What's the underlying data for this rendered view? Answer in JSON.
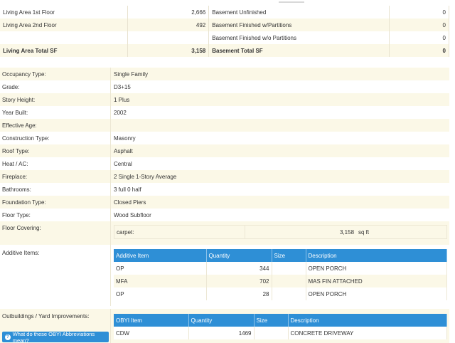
{
  "area_table": {
    "rows": [
      {
        "left_label": "Living Area 1st Floor",
        "left_value": "2,666",
        "right_label": "Basement Unfinished",
        "right_value": "0"
      },
      {
        "left_label": "Living Area 2nd Floor",
        "left_value": "492",
        "right_label": "Basement Finished w/Partitions",
        "right_value": "0"
      },
      {
        "left_label": "",
        "left_value": "",
        "right_label": "Basement Finished w/o Partitions",
        "right_value": "0"
      },
      {
        "left_label": "Living Area Total SF",
        "left_value": "3,158",
        "right_label": "Basement Total SF",
        "right_value": "0"
      }
    ]
  },
  "details": [
    {
      "label": "Occupancy Type:",
      "value": "Single Family"
    },
    {
      "label": "Grade:",
      "value": "D3+15"
    },
    {
      "label": "Story Height:",
      "value": "1 Plus"
    },
    {
      "label": "Year Built:",
      "value": "2002"
    },
    {
      "label": "Effective Age:",
      "value": ""
    },
    {
      "label": "Construction Type:",
      "value": "Masonry"
    },
    {
      "label": "Roof Type:",
      "value": "Asphalt"
    },
    {
      "label": "Heat / AC:",
      "value": "Central"
    },
    {
      "label": "Fireplace:",
      "value": "2 Single 1-Story Average"
    },
    {
      "label": "Bathrooms:",
      "value": "3 full 0 half"
    },
    {
      "label": "Foundation Type:",
      "value": "Closed Piers"
    },
    {
      "label": "Floor Type:",
      "value": "Wood Subfloor"
    }
  ],
  "floor_covering": {
    "label": "Floor Covering:",
    "material": "carpet:",
    "amount": "3,158",
    "unit": "sq ft"
  },
  "additive": {
    "label": "Additive Items:",
    "headers": [
      "Additive Item",
      "Quantity",
      "Size",
      "Description"
    ],
    "rows": [
      [
        "OP",
        "344",
        "",
        "OPEN PORCH"
      ],
      [
        "MFA",
        "702",
        "",
        "MAS FIN ATTACHED"
      ],
      [
        "OP",
        "28",
        "",
        "OPEN PORCH"
      ]
    ]
  },
  "outbuildings": {
    "label": "Outbuildings / Yard Improvements:",
    "headers": [
      "OBYI Item",
      "Quantity",
      "Size",
      "Description"
    ],
    "rows": [
      [
        "CDW",
        "1469",
        "",
        "CONCRETE DRIVEWAY"
      ]
    ],
    "help_button": "What do these OBYI Abbreviations mean?",
    "help_icon": "question-circle-icon"
  },
  "colors": {
    "header_blue": "#2e8fd6",
    "row_tan": "#fbf8e7"
  }
}
